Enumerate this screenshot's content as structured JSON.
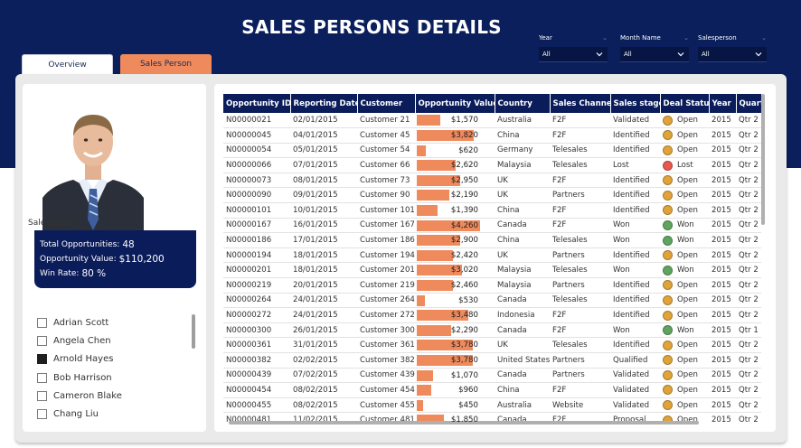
{
  "report": {
    "title": "SALES PERSONS DETAILS"
  },
  "tabs": [
    {
      "label": "Overview",
      "active": false
    },
    {
      "label": "Sales Person",
      "active": true
    }
  ],
  "filters": [
    {
      "label": "Year",
      "value": "All"
    },
    {
      "label": "Month Name",
      "value": "All"
    },
    {
      "label": "Salesperson",
      "value": "All"
    }
  ],
  "profile": {
    "total_opps_label": "Total Opportunities:",
    "total_opps_value": "48",
    "opp_value_label": "Opportunity Value:",
    "opp_value_value": "$110,200",
    "win_rate_label": "Win Rate:",
    "win_rate_value": "80 %"
  },
  "salesperson_slicer": {
    "heading": "Salesperson",
    "items": [
      {
        "name": "Adrian Scott",
        "checked": false
      },
      {
        "name": "Angela Chen",
        "checked": false
      },
      {
        "name": "Arnold Hayes",
        "checked": true
      },
      {
        "name": "Bob Harrison",
        "checked": false
      },
      {
        "name": "Cameron Blake",
        "checked": false
      },
      {
        "name": "Chang Liu",
        "checked": false
      }
    ]
  },
  "status_colors": {
    "Open": "#e0a33a",
    "Lost": "#e8584c",
    "Won": "#5fa45f"
  },
  "accent_color": "#ef8a5d",
  "table": {
    "columns": [
      "Opportunity ID",
      "Reporting Date",
      "Customer",
      "Opportunity Value",
      "Country",
      "Sales Channel",
      "Sales stage",
      "Deal Status",
      "Year",
      "Quarter"
    ],
    "value_max": 4260,
    "rows": [
      [
        "N00000021",
        "02/01/2015",
        "Customer 21",
        "$1,570",
        "Australia",
        "F2F",
        "Validated",
        "Open",
        "2015",
        "Qtr 2",
        1570
      ],
      [
        "N00000045",
        "04/01/2015",
        "Customer 45",
        "$3,820",
        "China",
        "F2F",
        "Identified",
        "Open",
        "2015",
        "Qtr 2",
        3820
      ],
      [
        "N00000054",
        "05/01/2015",
        "Customer 54",
        "$620",
        "Germany",
        "Telesales",
        "Identified",
        "Open",
        "2015",
        "Qtr 2",
        620
      ],
      [
        "N00000066",
        "07/01/2015",
        "Customer 66",
        "$2,620",
        "Malaysia",
        "Telesales",
        "Lost",
        "Lost",
        "2015",
        "Qtr 2",
        2620
      ],
      [
        "N00000073",
        "08/01/2015",
        "Customer 73",
        "$2,950",
        "UK",
        "F2F",
        "Identified",
        "Open",
        "2015",
        "Qtr 2",
        2950
      ],
      [
        "N00000090",
        "09/01/2015",
        "Customer 90",
        "$2,190",
        "UK",
        "Partners",
        "Identified",
        "Open",
        "2015",
        "Qtr 2",
        2190
      ],
      [
        "N00000101",
        "10/01/2015",
        "Customer 101",
        "$1,390",
        "China",
        "F2F",
        "Identified",
        "Open",
        "2015",
        "Qtr 2",
        1390
      ],
      [
        "N00000167",
        "16/01/2015",
        "Customer 167",
        "$4,260",
        "Canada",
        "F2F",
        "Won",
        "Won",
        "2015",
        "Qtr 2",
        4260
      ],
      [
        "N00000186",
        "17/01/2015",
        "Customer 186",
        "$2,900",
        "China",
        "Telesales",
        "Won",
        "Won",
        "2015",
        "Qtr 2",
        2900
      ],
      [
        "N00000194",
        "18/01/2015",
        "Customer 194",
        "$2,420",
        "UK",
        "Partners",
        "Identified",
        "Open",
        "2015",
        "Qtr 2",
        2420
      ],
      [
        "N00000201",
        "18/01/2015",
        "Customer 201",
        "$3,020",
        "Malaysia",
        "Telesales",
        "Won",
        "Won",
        "2015",
        "Qtr 2",
        3020
      ],
      [
        "N00000219",
        "20/01/2015",
        "Customer 219",
        "$2,460",
        "Malaysia",
        "Partners",
        "Identified",
        "Open",
        "2015",
        "Qtr 2",
        2460
      ],
      [
        "N00000264",
        "24/01/2015",
        "Customer 264",
        "$530",
        "Canada",
        "Telesales",
        "Identified",
        "Open",
        "2015",
        "Qtr 2",
        530
      ],
      [
        "N00000272",
        "24/01/2015",
        "Customer 272",
        "$3,480",
        "Indonesia",
        "F2F",
        "Identified",
        "Open",
        "2015",
        "Qtr 2",
        3480
      ],
      [
        "N00000300",
        "26/01/2015",
        "Customer 300",
        "$2,290",
        "Canada",
        "F2F",
        "Won",
        "Won",
        "2015",
        "Qtr 1",
        2290
      ],
      [
        "N00000361",
        "31/01/2015",
        "Customer 361",
        "$3,780",
        "UK",
        "Telesales",
        "Identified",
        "Open",
        "2015",
        "Qtr 2",
        3780
      ],
      [
        "N00000382",
        "02/02/2015",
        "Customer 382",
        "$3,780",
        "United States",
        "Partners",
        "Qualified",
        "Open",
        "2015",
        "Qtr 2",
        3780
      ],
      [
        "N00000439",
        "07/02/2015",
        "Customer 439",
        "$1,070",
        "Canada",
        "Partners",
        "Validated",
        "Open",
        "2015",
        "Qtr 2",
        1070
      ],
      [
        "N00000454",
        "08/02/2015",
        "Customer 454",
        "$960",
        "China",
        "F2F",
        "Validated",
        "Open",
        "2015",
        "Qtr 2",
        960
      ],
      [
        "N00000455",
        "08/02/2015",
        "Customer 455",
        "$450",
        "Australia",
        "Website",
        "Validated",
        "Open",
        "2015",
        "Qtr 2",
        450
      ],
      [
        "N00000481",
        "11/02/2015",
        "Customer 481",
        "$1,850",
        "Canada",
        "F2F",
        "Proposal",
        "Open",
        "2015",
        "Qtr 2",
        1850
      ]
    ]
  }
}
